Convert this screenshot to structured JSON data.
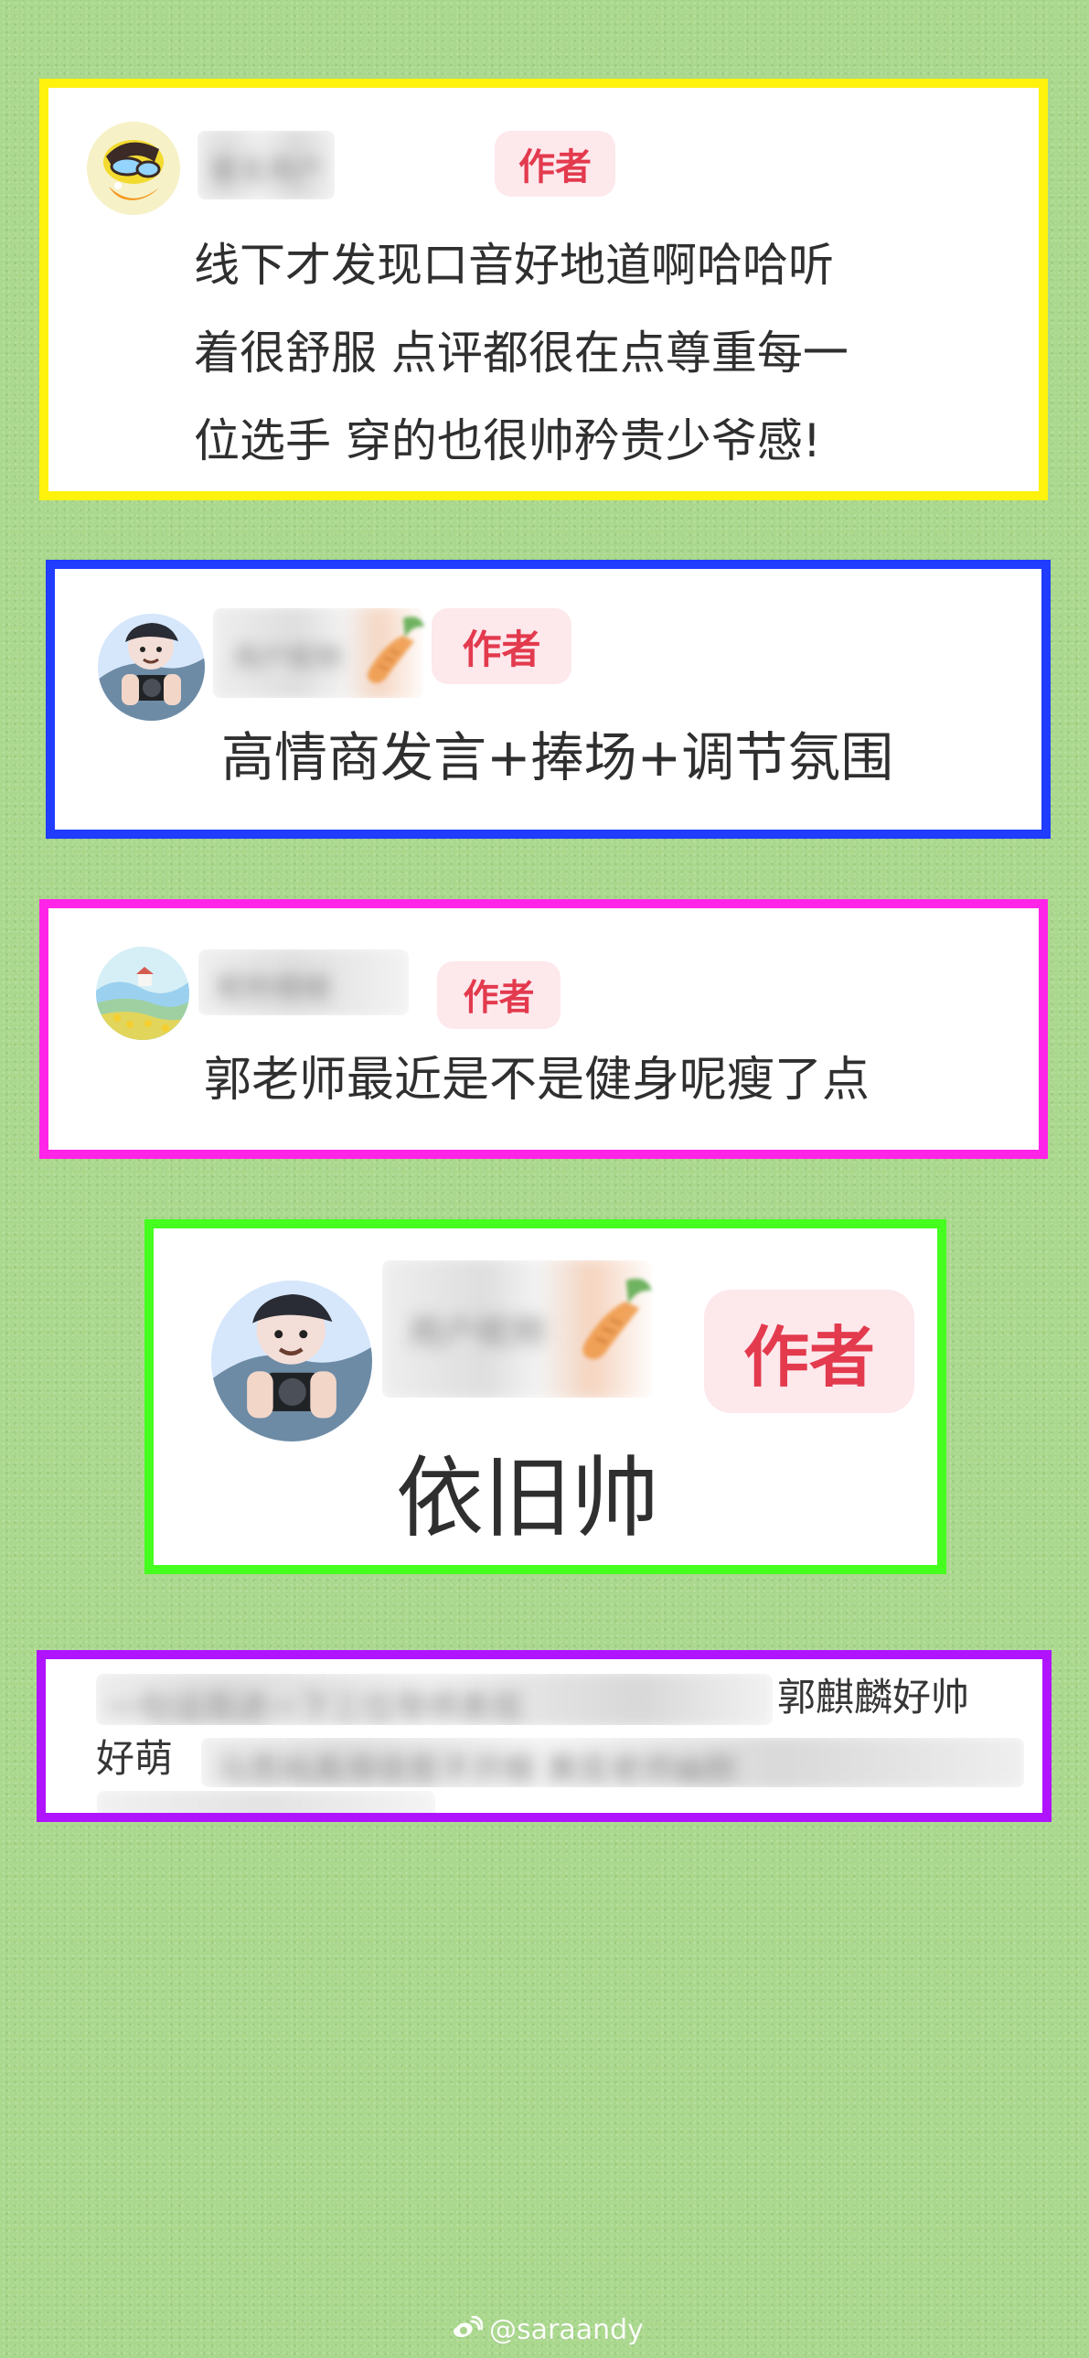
{
  "cards": [
    {
      "author_badge": "作者",
      "comment_text": "线下才发现口音好地道啊哈哈听\n着很舒服 点评都很在点尊重每一\n位选手 穿的也很帅矜贵少爷感!",
      "border_color": "#fff20d"
    },
    {
      "author_badge": "作者",
      "comment_text": "高情商发言+捧场+调节氛围",
      "border_color": "#1f3cff"
    },
    {
      "author_badge": "作者",
      "comment_text": "郭老师最近是不是健身呢瘦了点",
      "border_color": "#ff24e8"
    },
    {
      "author_badge": "作者",
      "comment_text": "依旧帅",
      "border_color": "#45ff1e"
    },
    {
      "visible_text_1": "郭麒麟好帅",
      "visible_text_2": "好萌",
      "border_color": "#b014ff"
    }
  ],
  "watermark": {
    "handle": "@saraandy",
    "icon": "weibo-logo-icon"
  }
}
